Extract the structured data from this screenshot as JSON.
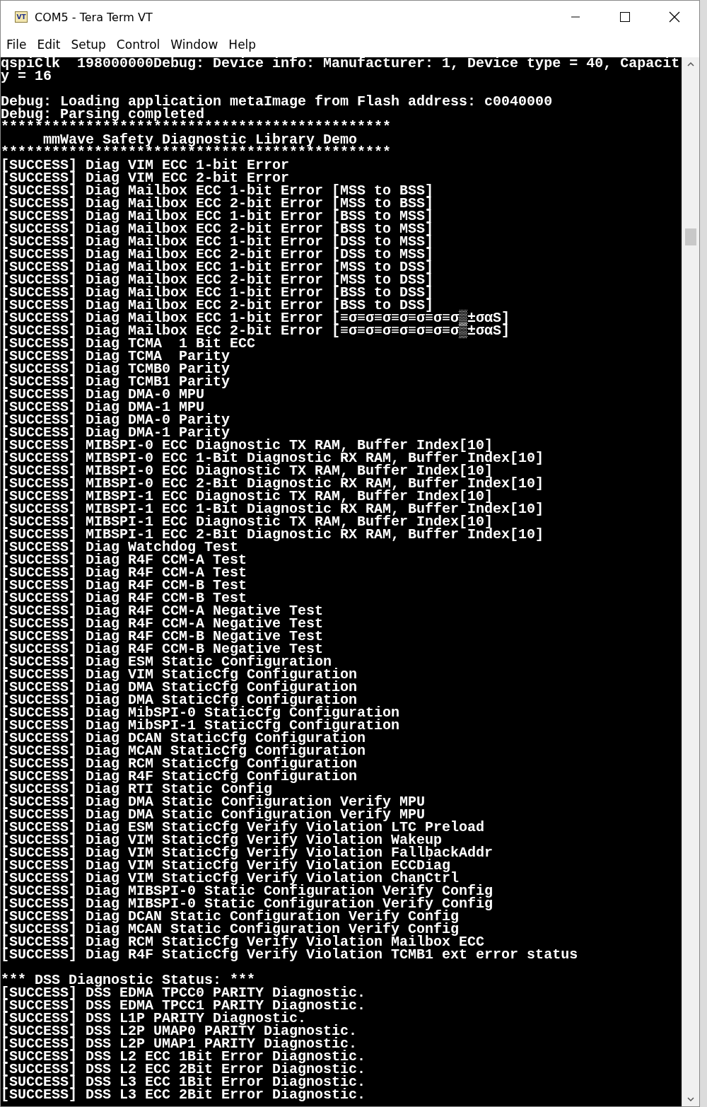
{
  "window": {
    "title": "COM5 - Tera Term VT",
    "app_icon_label": "VT"
  },
  "menu": [
    "File",
    "Edit",
    "Setup",
    "Control",
    "Window",
    "Help"
  ],
  "terminal": {
    "blocks": [
      [
        "qspiClk  198000000Debug: Device info: Manufacturer: 1, Device type = 40, Capacit",
        "y = 16"
      ],
      [
        "Debug: Loading application metaImage from Flash address: c0040000",
        "Debug: Parsing completed",
        "**********************************************",
        "     mmWave Safety Diagnostic Library Demo",
        "**********************************************",
        "[SUCCESS] Diag VIM ECC 1-bit Error",
        "[SUCCESS] Diag VIM ECC 2-bit Error",
        "[SUCCESS] Diag Mailbox ECC 1-bit Error [MSS to BSS]",
        "[SUCCESS] Diag Mailbox ECC 2-bit Error [MSS to BSS]",
        "[SUCCESS] Diag Mailbox ECC 1-bit Error [BSS to MSS]",
        "[SUCCESS] Diag Mailbox ECC 2-bit Error [BSS to MSS]",
        "[SUCCESS] Diag Mailbox ECC 1-bit Error [DSS to MSS]",
        "[SUCCESS] Diag Mailbox ECC 2-bit Error [DSS to MSS]",
        "[SUCCESS] Diag Mailbox ECC 1-bit Error [MSS to DSS]",
        "[SUCCESS] Diag Mailbox ECC 2-bit Error [MSS to DSS]",
        "[SUCCESS] Diag Mailbox ECC 1-bit Error [BSS to DSS]",
        "[SUCCESS] Diag Mailbox ECC 2-bit Error [BSS to DSS]",
        "[SUCCESS] Diag Mailbox ECC 1-bit Error [≡σ≡σ≡σ≡σ≡σ≡σ≡σ▒±σαS]",
        "[SUCCESS] Diag Mailbox ECC 2-bit Error [≡σ≡σ≡σ≡σ≡σ≡σ≡σ▒±σαS]",
        "[SUCCESS] Diag TCMA  1 Bit ECC",
        "[SUCCESS] Diag TCMA  Parity",
        "[SUCCESS] Diag TCMB0 Parity",
        "[SUCCESS] Diag TCMB1 Parity",
        "[SUCCESS] Diag DMA-0 MPU",
        "[SUCCESS] Diag DMA-1 MPU",
        "[SUCCESS] Diag DMA-0 Parity",
        "[SUCCESS] Diag DMA-1 Parity",
        "[SUCCESS] MIBSPI-0 ECC Diagnostic TX RAM, Buffer Index[10]",
        "[SUCCESS] MIBSPI-0 ECC 1-Bit Diagnostic RX RAM, Buffer Index[10]",
        "[SUCCESS] MIBSPI-0 ECC Diagnostic TX RAM, Buffer Index[10]",
        "[SUCCESS] MIBSPI-0 ECC 2-Bit Diagnostic RX RAM, Buffer Index[10]",
        "[SUCCESS] MIBSPI-1 ECC Diagnostic TX RAM, Buffer Index[10]",
        "[SUCCESS] MIBSPI-1 ECC 1-Bit Diagnostic RX RAM, Buffer Index[10]",
        "[SUCCESS] MIBSPI-1 ECC Diagnostic TX RAM, Buffer Index[10]",
        "[SUCCESS] MIBSPI-1 ECC 2-Bit Diagnostic RX RAM, Buffer Index[10]",
        "[SUCCESS] Diag Watchdog Test",
        "[SUCCESS] Diag R4F CCM-A Test",
        "[SUCCESS] Diag R4F CCM-A Test",
        "[SUCCESS] Diag R4F CCM-B Test",
        "[SUCCESS] Diag R4F CCM-B Test",
        "[SUCCESS] Diag R4F CCM-A Negative Test",
        "[SUCCESS] Diag R4F CCM-A Negative Test",
        "[SUCCESS] Diag R4F CCM-B Negative Test",
        "[SUCCESS] Diag R4F CCM-B Negative Test",
        "[SUCCESS] Diag ESM Static Configuration",
        "[SUCCESS] Diag VIM StaticCfg Configuration",
        "[SUCCESS] Diag DMA StaticCfg Configuration",
        "[SUCCESS] Diag DMA StaticCfg Configuration",
        "[SUCCESS] Diag MibSPI-0 StaticCfg Configuration",
        "[SUCCESS] Diag MibSPI-1 StaticCfg Configuration",
        "[SUCCESS] Diag DCAN StaticCfg Configuration",
        "[SUCCESS] Diag MCAN StaticCfg Configuration",
        "[SUCCESS] Diag RCM StaticCfg Configuration",
        "[SUCCESS] Diag R4F StaticCfg Configuration",
        "[SUCCESS] Diag RTI Static Config",
        "[SUCCESS] Diag DMA Static Configuration Verify MPU",
        "[SUCCESS] Diag DMA Static Configuration Verify MPU",
        "[SUCCESS] Diag ESM StaticCfg Verify Violation LTC Preload",
        "[SUCCESS] Diag VIM StaticCfg Verify Violation Wakeup",
        "[SUCCESS] Diag VIM StaticCfg Verify Violation FallbackAddr",
        "[SUCCESS] Diag VIM StaticCfg Verify Violation ECCDiag",
        "[SUCCESS] Diag VIM StaticCfg Verify Violation ChanCtrl",
        "[SUCCESS] Diag MIBSPI-0 Static Configuration Verify Config",
        "[SUCCESS] Diag MIBSPI-0 Static Configuration Verify Config",
        "[SUCCESS] Diag DCAN Static Configuration Verify Config",
        "[SUCCESS] Diag MCAN Static Configuration Verify Config",
        "[SUCCESS] Diag RCM StaticCfg Verify Violation Mailbox ECC",
        "[SUCCESS] Diag R4F StaticCfg Verify Violation TCMB1 ext error status"
      ],
      [
        "*** DSS Diagnostic Status: ***",
        "[SUCCESS] DSS EDMA TPCC0 PARITY Diagnostic.",
        "[SUCCESS] DSS EDMA TPCC1 PARITY Diagnostic.",
        "[SUCCESS] DSS L1P PARITY Diagnostic.",
        "[SUCCESS] DSS L2P UMAP0 PARITY Diagnostic.",
        "[SUCCESS] DSS L2P UMAP1 PARITY Diagnostic.",
        "[SUCCESS] DSS L2 ECC 1Bit Error Diagnostic.",
        "[SUCCESS] DSS L2 ECC 2Bit Error Diagnostic.",
        "[SUCCESS] DSS L3 ECC 1Bit Error Diagnostic.",
        "[SUCCESS] DSS L3 ECC 2Bit Error Diagnostic."
      ]
    ]
  }
}
